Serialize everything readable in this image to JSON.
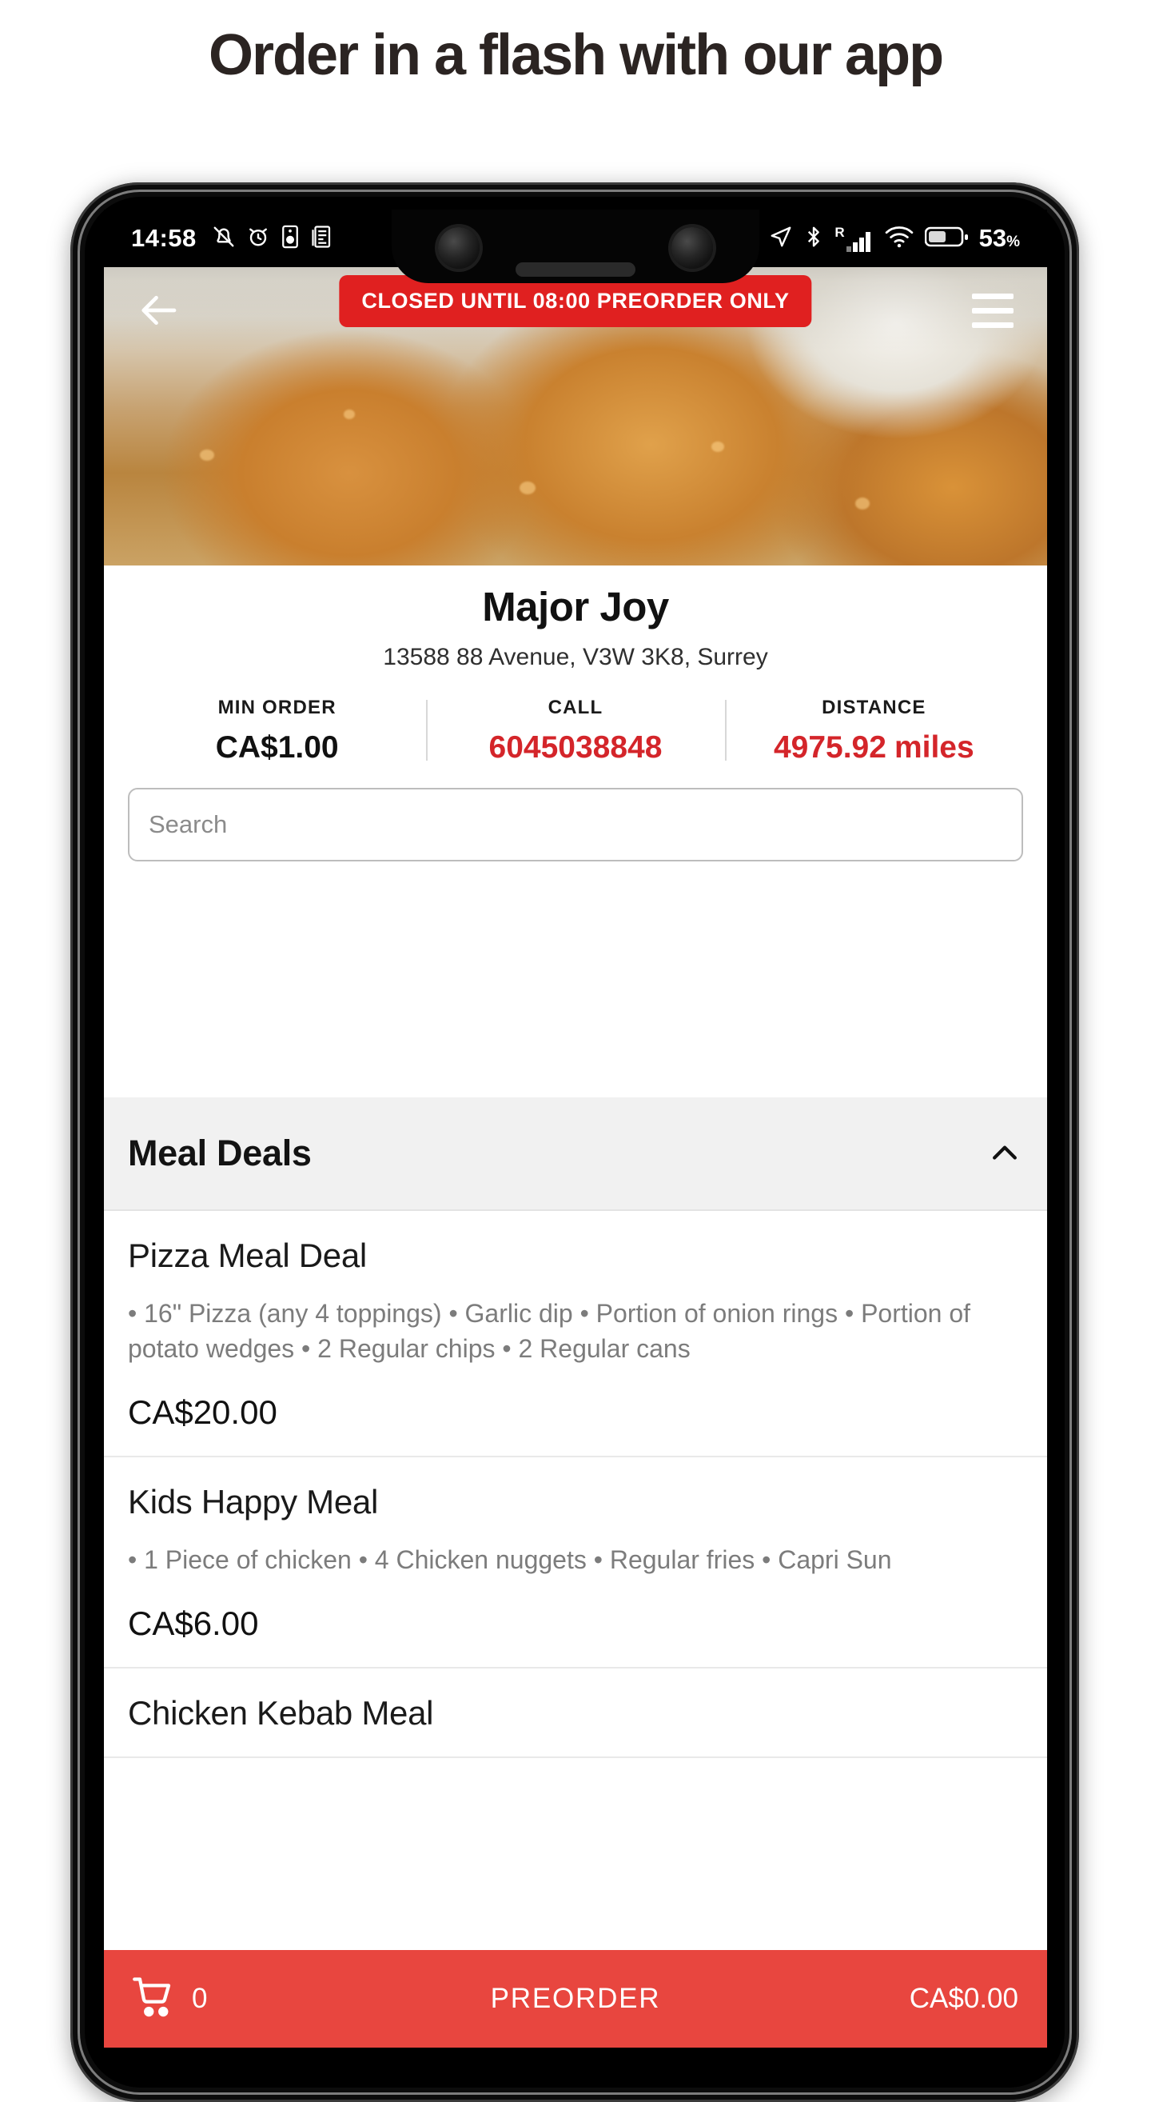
{
  "promo": {
    "headline": "Order in a flash with our app"
  },
  "status_bar": {
    "time": "14:58",
    "left_icons": [
      "bell-off-icon",
      "alarm-icon",
      "speaker-icon",
      "news-icon"
    ],
    "right_icons": [
      "location-arrow-icon",
      "bluetooth-icon",
      "roaming-signal-icon",
      "wifi-icon",
      "battery-icon"
    ],
    "roaming_label": "R",
    "battery_percent": "53",
    "percent_sign": "%"
  },
  "hero": {
    "back_icon": "back-arrow-icon",
    "menu_icon": "hamburger-menu-icon",
    "closed_banner": "CLOSED UNTIL 08:00 PREORDER ONLY",
    "banner_color": "#e02020"
  },
  "shop": {
    "name": "Major Joy",
    "address": "13588 88 Avenue, V3W 3K8, Surrey",
    "stats": [
      {
        "label": "MIN ORDER",
        "value": "CA$1.00",
        "unit": "",
        "accent": false
      },
      {
        "label": "CALL",
        "value": "6045038848",
        "unit": "",
        "accent": true
      },
      {
        "label": "DISTANCE",
        "value": "4975.92",
        "unit": "miles",
        "accent": true
      }
    ]
  },
  "search": {
    "placeholder": "Search",
    "value": ""
  },
  "menu": {
    "category": {
      "title": "Meal Deals",
      "collapse_icon": "chevron-up-icon",
      "expanded": true
    },
    "items": [
      {
        "name": "Pizza Meal Deal",
        "description": "• 16\" Pizza (any 4 toppings) • Garlic dip • Portion of onion rings • Portion of potato wedges • 2 Regular chips • 2 Regular cans",
        "price": "CA$20.00"
      },
      {
        "name": "Kids Happy Meal",
        "description": "• 1 Piece of chicken • 4 Chicken nuggets • Regular fries • Capri Sun",
        "price": "CA$6.00"
      },
      {
        "name": "Chicken Kebab Meal",
        "description": "",
        "price": ""
      }
    ]
  },
  "bottom_bar": {
    "cart_icon": "shopping-cart-icon",
    "cart_count": "0",
    "action_label": "PREORDER",
    "total": "CA$0.00",
    "bar_color": "#e8463f"
  }
}
